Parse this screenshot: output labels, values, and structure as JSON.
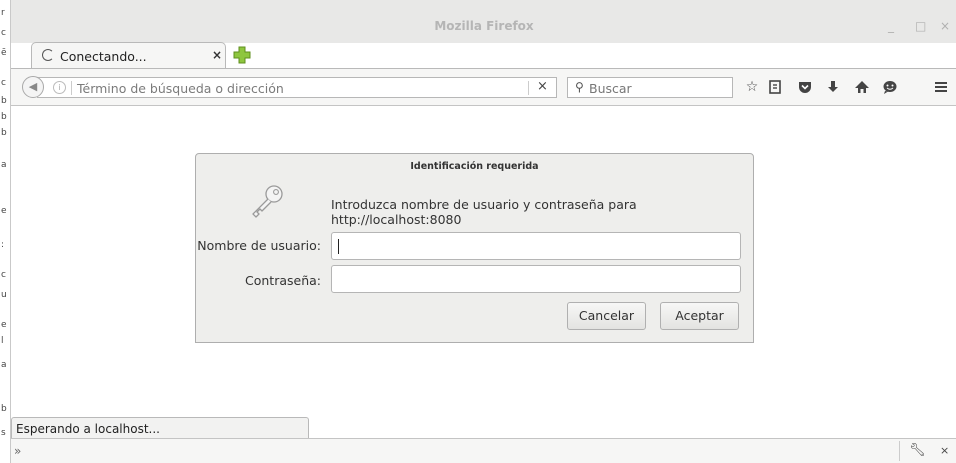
{
  "window": {
    "title": "Mozilla Firefox",
    "minimize": "_",
    "maximize": "□",
    "close": "×"
  },
  "tab": {
    "label": "Conectando...",
    "close": "×"
  },
  "navbar": {
    "url_placeholder": "Término de búsqueda o dirección",
    "clear": "×",
    "search_placeholder": "Buscar"
  },
  "dialog": {
    "title": "Identificación requerida",
    "message": "Introduzca nombre de usuario y contraseña para http://localhost:8080",
    "username_label": "Nombre de usuario:",
    "username_value": "",
    "password_label": "Contraseña:",
    "password_value": "",
    "cancel": "Cancelar",
    "accept": "Aceptar"
  },
  "status": {
    "text": "Esperando a localhost..."
  },
  "bottombar": {
    "chevron": "»",
    "close": "×"
  }
}
